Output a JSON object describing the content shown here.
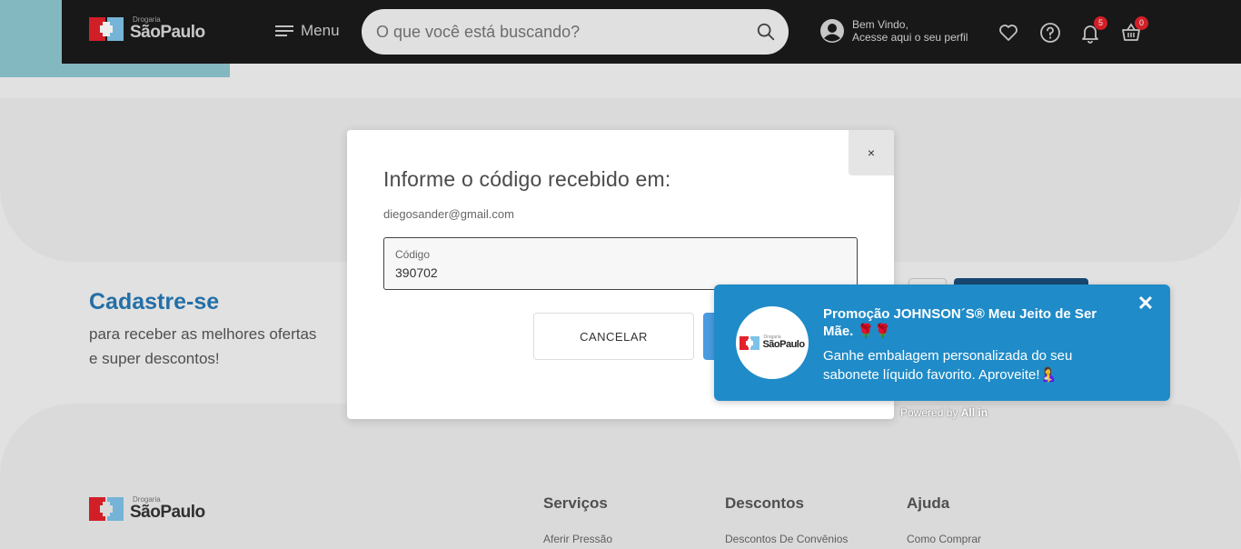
{
  "header": {
    "logo": {
      "small": "Drogaria",
      "big": "SãoPaulo"
    },
    "menu_label": "Menu",
    "search": {
      "placeholder": "O que você está buscando?",
      "value": ""
    },
    "profile": {
      "line1": "Bem Vindo,",
      "line2": "Acesse aqui o seu perfil"
    },
    "notifications_count": "5",
    "cart_count": "0"
  },
  "signup": {
    "title": "Cadastre-se",
    "line1": "para receber as melhores ofertas",
    "line2": "e super descontos!"
  },
  "modal": {
    "close_label": "×",
    "title": "Informe o código recebido em:",
    "email": "diegosander@gmail.com",
    "code_label": "Código",
    "code_value": "390702",
    "cancel_label": "CANCELAR"
  },
  "push": {
    "logo": {
      "small": "Drogaria",
      "big": "SãoPaulo"
    },
    "title": "Promoção JOHNSON´S® Meu Jeito de Ser Mãe. 🌹🌹",
    "body": "Ganhe embalagem personalizada do seu sabonete líquido favorito. Aproveite!🤱",
    "close_label": "✕",
    "powered_prefix": "Powered by",
    "powered_brand": "All in"
  },
  "footer": {
    "logo": {
      "small": "Drogaria",
      "big": "SãoPaulo"
    },
    "columns": [
      {
        "title": "Serviços",
        "first_link": "Aferir Pressão"
      },
      {
        "title": "Descontos",
        "first_link": "Descontos De Convênios"
      },
      {
        "title": "Ajuda",
        "first_link": "Como Comprar"
      }
    ]
  },
  "colors": {
    "header_bg": "#1a1a1a",
    "brand_red": "#e2222b",
    "brand_blue": "#7ec2e8",
    "signup_title": "#2778b3",
    "push_bg": "#1f8bc8",
    "confirm_button": "#4a9be0"
  }
}
